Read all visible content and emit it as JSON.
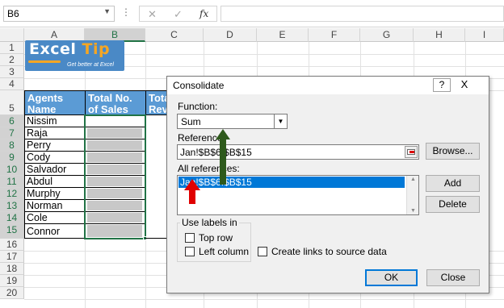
{
  "formula_bar": {
    "name_box": "B6",
    "cancel_icon": "✕",
    "enter_icon": "✓",
    "fx_label": "fx",
    "formula": ""
  },
  "columns": [
    "A",
    "B",
    "C",
    "D",
    "E",
    "F",
    "G",
    "H",
    "I"
  ],
  "rows": [
    "1",
    "2",
    "3",
    "4",
    "5",
    "6",
    "7",
    "8",
    "9",
    "10",
    "11",
    "12",
    "13",
    "14",
    "15",
    "16",
    "17",
    "18",
    "19",
    "20"
  ],
  "logo": {
    "word": "Excel",
    "word2": "Tip",
    "tagline": "Get better at Excel"
  },
  "table": {
    "headers": [
      "Agents Name",
      "Total No. of Sales",
      "Tota Rev"
    ],
    "agents": [
      "Nissim",
      "Raja",
      "Perry",
      "Cody",
      "Salvador",
      "Abdul",
      "Murphy",
      "Norman",
      "Cole",
      "Connor"
    ]
  },
  "dialog": {
    "title": "Consolidate",
    "help_btn": "?",
    "close_btn": "X",
    "function_label": "Function:",
    "function_value": "Sum",
    "reference_label": "Reference:",
    "reference_value": "Jan!$B$6:$B$15",
    "browse_btn": "Browse...",
    "all_refs_label": "All references:",
    "all_refs_item": "Jan!$B$6:$B$15",
    "add_btn": "Add",
    "delete_btn": "Delete",
    "use_labels_label": "Use labels in",
    "top_row_label": "Top row",
    "left_column_label": "Left column",
    "create_links_label": "Create links to source data",
    "ok_btn": "OK",
    "close_btn2": "Close"
  },
  "colors": {
    "header_blue": "#5b9bd5",
    "excel_green": "#217346",
    "arrow_red": "#e00000",
    "arrow_green": "#2e5a1c"
  }
}
